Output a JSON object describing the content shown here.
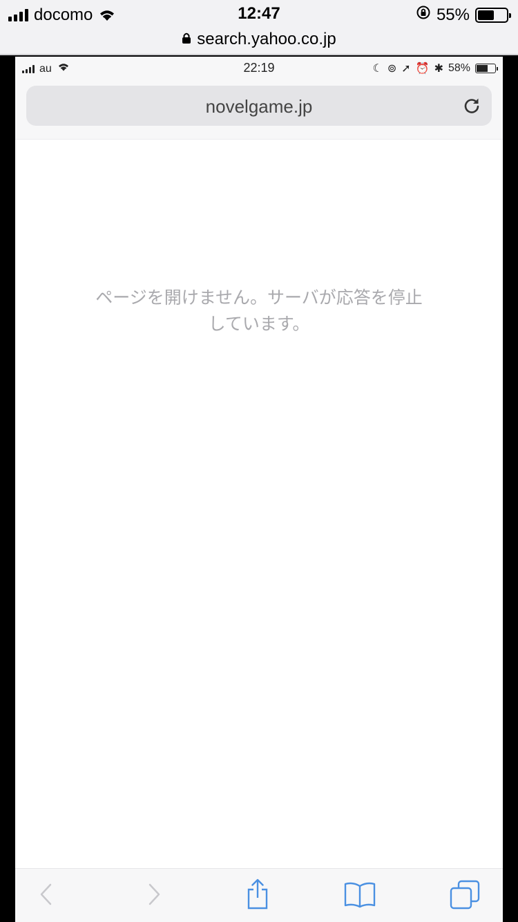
{
  "outer_status": {
    "carrier": "docomo",
    "time": "12:47",
    "battery": "55%"
  },
  "outer_url": {
    "host": "search.yahoo.co.jp"
  },
  "inner_status": {
    "carrier": "au",
    "time": "22:19",
    "battery": "58%"
  },
  "address_bar": {
    "url": "novelgame.jp"
  },
  "content": {
    "error_line1": "ページを開けません。サーバが応答を停止",
    "error_line2": "しています。"
  },
  "colors": {
    "toolbar_icon_active": "#4a90e2",
    "toolbar_icon_disabled": "#c8c8cc",
    "error_text": "#a9a9ad"
  },
  "icons": {
    "back": "chevron-left-icon",
    "forward": "chevron-right-icon",
    "share": "share-icon",
    "bookmarks": "book-icon",
    "tabs": "tabs-icon",
    "reload": "reload-icon"
  }
}
